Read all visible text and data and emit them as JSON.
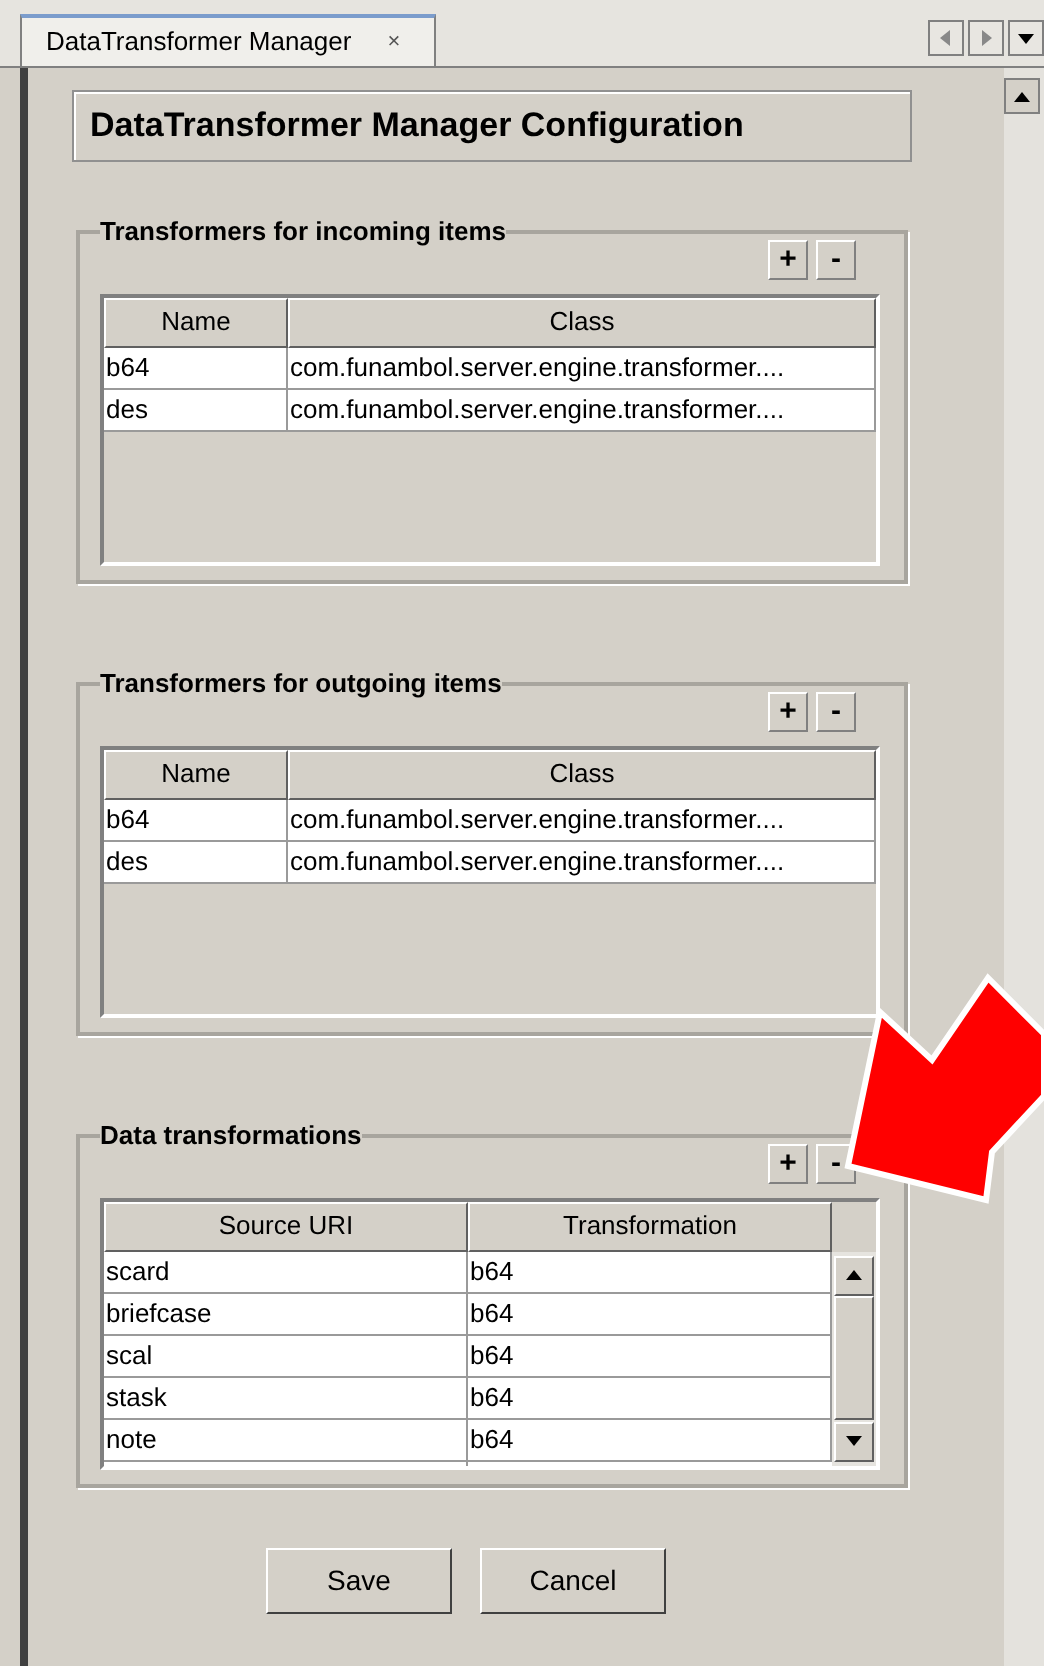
{
  "tab": {
    "title": "DataTransformer Manager",
    "close": "×",
    "selected": true
  },
  "heading": "DataTransformer Manager Configuration",
  "groups": [
    {
      "title": "Transformers for incoming items",
      "add": "+",
      "remove": "-",
      "columns": [
        "Name",
        "Class"
      ],
      "scrollable": false,
      "rows": [
        {
          "cells": [
            "b64",
            "com.funambol.server.engine.transformer...."
          ]
        },
        {
          "cells": [
            "des",
            "com.funambol.server.engine.transformer...."
          ]
        }
      ]
    },
    {
      "title": "Transformers for outgoing items",
      "add": "+",
      "remove": "-",
      "columns": [
        "Name",
        "Class"
      ],
      "scrollable": false,
      "rows": [
        {
          "cells": [
            "b64",
            "com.funambol.server.engine.transformer...."
          ]
        },
        {
          "cells": [
            "des",
            "com.funambol.server.engine.transformer...."
          ]
        }
      ]
    },
    {
      "title": "Data transformations",
      "add": "+",
      "remove": "-",
      "columns": [
        "Source URI",
        "Transformation"
      ],
      "scrollable": true,
      "rows": [
        {
          "cells": [
            "scard",
            "b64"
          ]
        },
        {
          "cells": [
            "briefcase",
            "b64"
          ]
        },
        {
          "cells": [
            "scal",
            "b64"
          ]
        },
        {
          "cells": [
            "stask",
            "b64"
          ]
        },
        {
          "cells": [
            "note",
            "b64"
          ]
        }
      ]
    }
  ],
  "buttons": [
    "Save",
    "Cancel"
  ]
}
